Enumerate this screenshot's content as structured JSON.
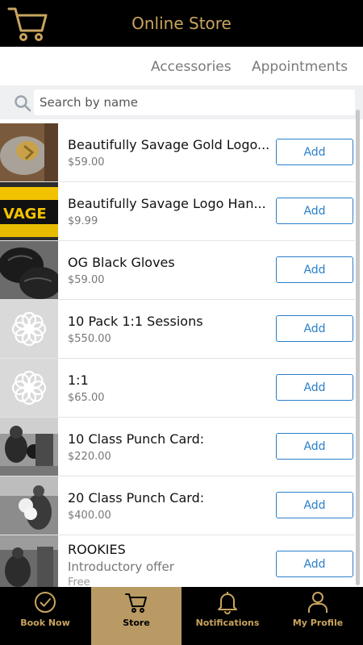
{
  "header": {
    "title": "Online Store",
    "cart_icon": "cart-icon"
  },
  "tabs": [
    "Accessories",
    "Appointments"
  ],
  "search": {
    "placeholder": "Search by name",
    "value": "",
    "icon": "search-icon"
  },
  "products": [
    {
      "name": "Beautifully Savage Gold Logo...",
      "price": "$59.00",
      "add_label": "Add",
      "thumb": "gold-gloves-photo"
    },
    {
      "name": "Beautifully Savage Logo Han...",
      "price": "$9.99",
      "add_label": "Add",
      "thumb": "hand-wraps-photo"
    },
    {
      "name": "OG Black Gloves",
      "price": "$59.00",
      "add_label": "Add",
      "thumb": "black-gloves-photo"
    },
    {
      "name": "10 Pack 1:1 Sessions",
      "price": "$550.00",
      "add_label": "Add",
      "thumb": "placeholder-logo"
    },
    {
      "name": "1:1",
      "price": "$65.00",
      "add_label": "Add",
      "thumb": "placeholder-logo"
    },
    {
      "name": "10 Class Punch Card:",
      "price": "$220.00",
      "add_label": "Add",
      "thumb": "boxer-photo"
    },
    {
      "name": "20 Class Punch Card:",
      "price": "$400.00",
      "add_label": "Add",
      "thumb": "boxer-photo-2"
    },
    {
      "name": "ROOKIES",
      "subtitle": "Introductory offer",
      "price": "Free",
      "add_label": "Add",
      "thumb": "gym-photo"
    }
  ],
  "nav": [
    {
      "label": "Book Now",
      "icon": "check-circle-icon",
      "active": false
    },
    {
      "label": "Store",
      "icon": "cart-icon",
      "active": true
    },
    {
      "label": "Notifications",
      "icon": "bell-icon",
      "active": false
    },
    {
      "label": "My Profile",
      "icon": "person-icon",
      "active": false
    }
  ],
  "colors": {
    "accent": "#c9a45e",
    "active_tab": "#b99a64",
    "link_blue": "#2a7fc9"
  }
}
